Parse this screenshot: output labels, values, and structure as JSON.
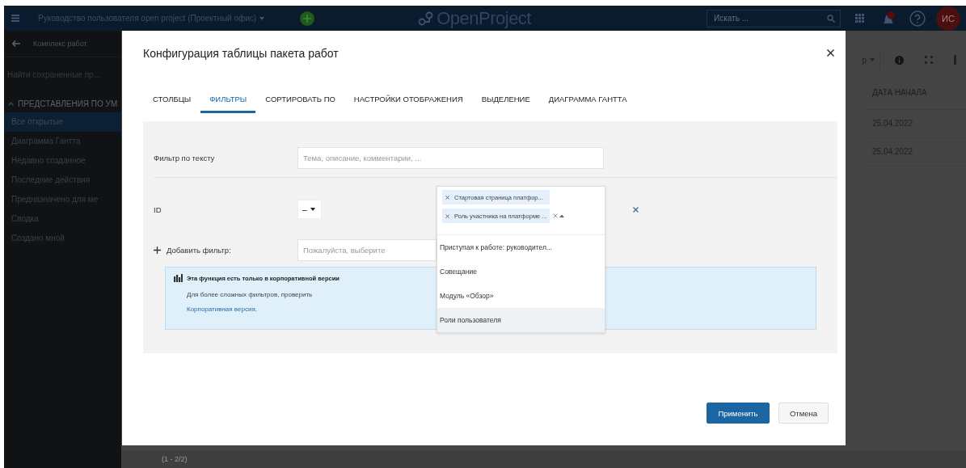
{
  "header": {
    "project": "Руководство пользователя open project (Проектный офис)",
    "logo": "OpenProject",
    "search": {
      "placeholder": "Искать ..."
    },
    "avatar": "ИС",
    "notifications": true
  },
  "sidebar": {
    "back": "Комплекс работ",
    "search": {
      "placeholder": "Найти сохраненные пр..."
    },
    "section": {
      "label": "ПРЕДСТАВЛЕНИЯ ПО УМ",
      "expanded": true
    },
    "items": [
      {
        "label": "Все открытые",
        "selected": true
      },
      {
        "label": "Диаграмма Гантта",
        "selected": false
      },
      {
        "label": "Недавно созданное",
        "selected": false
      },
      {
        "label": "Последние действия",
        "selected": false
      },
      {
        "label": "Предназначено для ме",
        "selected": false
      },
      {
        "label": "Сводка",
        "selected": false
      },
      {
        "label": "Создано мной",
        "selected": false
      }
    ]
  },
  "main": {
    "toolbar": {
      "button": "р"
    },
    "table": {
      "columns": [
        "ДАТА НАЧАЛА"
      ],
      "rows": [
        [
          "25.04.2022"
        ],
        [
          "25.04.2022"
        ]
      ]
    },
    "footer": "(1 - 2/2)"
  },
  "modal": {
    "title": "Конфигурация таблицы пакета работ",
    "tabs": [
      {
        "label": "СТОЛБЦЫ",
        "selected": false
      },
      {
        "label": "ФИЛЬТРЫ",
        "selected": true
      },
      {
        "label": "СОРТИРОВАТЬ ПО",
        "selected": false
      },
      {
        "label": "НАСТРОЙКИ ОТОБРАЖЕНИЯ",
        "selected": false
      },
      {
        "label": "ВЫДЕЛЕНИЕ",
        "selected": false
      },
      {
        "label": "ДИАГРАММА ГАНТТА",
        "selected": false
      }
    ],
    "text_filter": {
      "label": "Фильтр по тексту",
      "placeholder": "Тема, описание, комментарии, ..."
    },
    "id_filter": {
      "label": "ID",
      "operator": "–",
      "chips": [
        "Стартовая страница платфор...",
        "Роль участника на платформе ..."
      ],
      "options": [
        {
          "label": "Приступая к работе: руководител...",
          "selected": false
        },
        {
          "label": "Совещание",
          "selected": false
        },
        {
          "label": "Модуль «Обзор»",
          "selected": false
        },
        {
          "label": "Роли пользователя",
          "selected": true
        }
      ]
    },
    "add_filter": {
      "label": "Добавить фильтр:",
      "placeholder": "Пожалуйста, выберите"
    },
    "enterprise": {
      "title": "Эта функция есть только в корпоративной версии",
      "text": "Для более сложных фильтров, проверить",
      "link": "Корпоративная версия."
    },
    "buttons": [
      {
        "label": "Применить",
        "kind": "primary"
      },
      {
        "label": "Отмена",
        "kind": "secondary"
      }
    ]
  }
}
